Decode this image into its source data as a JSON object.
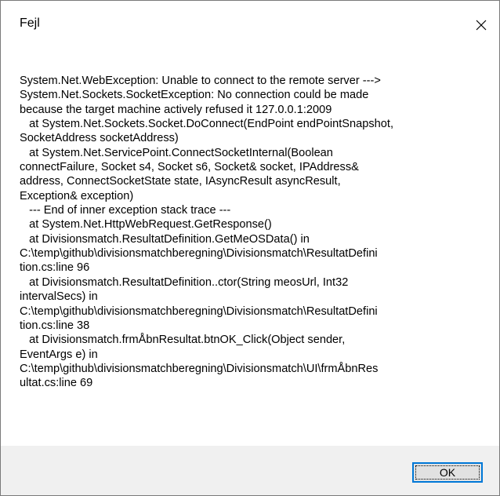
{
  "dialog": {
    "title": "Fejl",
    "close_icon": "close-icon",
    "message": "System.Net.WebException: Unable to connect to the remote server --->\nSystem.Net.Sockets.SocketException: No connection could be made\nbecause the target machine actively refused it 127.0.0.1:2009\n   at System.Net.Sockets.Socket.DoConnect(EndPoint endPointSnapshot,\nSocketAddress socketAddress)\n   at System.Net.ServicePoint.ConnectSocketInternal(Boolean\nconnectFailure, Socket s4, Socket s6, Socket& socket, IPAddress&\naddress, ConnectSocketState state, IAsyncResult asyncResult,\nException& exception)\n   --- End of inner exception stack trace ---\n   at System.Net.HttpWebRequest.GetResponse()\n   at Divisionsmatch.ResultatDefinition.GetMeOSData() in\nC:\\temp\\github\\divisionsmatchberegning\\Divisionsmatch\\ResultatDefini\ntion.cs:line 96\n   at Divisionsmatch.ResultatDefinition..ctor(String meosUrl, Int32\nintervalSecs) in\nC:\\temp\\github\\divisionsmatchberegning\\Divisionsmatch\\ResultatDefini\ntion.cs:line 38\n   at Divisionsmatch.frmÅbnResultat.btnOK_Click(Object sender,\nEventArgs e) in\nC:\\temp\\github\\divisionsmatchberegning\\Divisionsmatch\\UI\\frmÅbnRes\nultat.cs:line 69",
    "ok_label": "OK",
    "colors": {
      "footer_bg": "#f0f0f0",
      "button_bg": "#e1e1e1",
      "focus_border": "#0078d7"
    }
  }
}
